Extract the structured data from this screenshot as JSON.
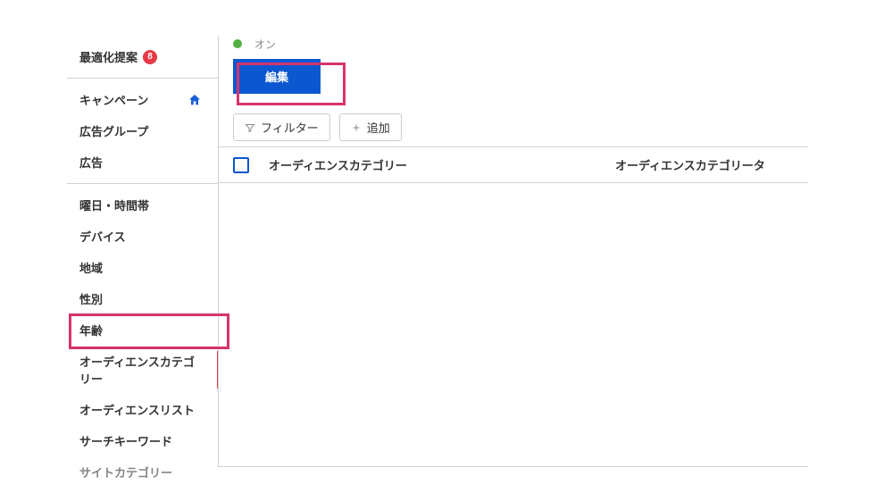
{
  "sidebar": {
    "section1": {
      "optimization": "最適化提案",
      "badge": "8"
    },
    "section2": {
      "campaign": "キャンペーン",
      "adgroup": "広告グループ",
      "ads": "広告"
    },
    "section3": {
      "daytime": "曜日・時間帯",
      "device": "デバイス",
      "region": "地域",
      "gender": "性別",
      "age": "年齢",
      "audience_category": "オーディエンスカテゴリー",
      "audience_list": "オーディエンスリスト",
      "search_keyword": "サーチキーワード",
      "site_category": "サイトカテゴリー"
    }
  },
  "topbar": {
    "status_on": "オン"
  },
  "toolbar": {
    "edit": "編集",
    "filter": "フィルター",
    "add": "追加"
  },
  "table": {
    "col1": "オーディエンスカテゴリー",
    "col2": "オーディエンスカテゴリータ"
  }
}
